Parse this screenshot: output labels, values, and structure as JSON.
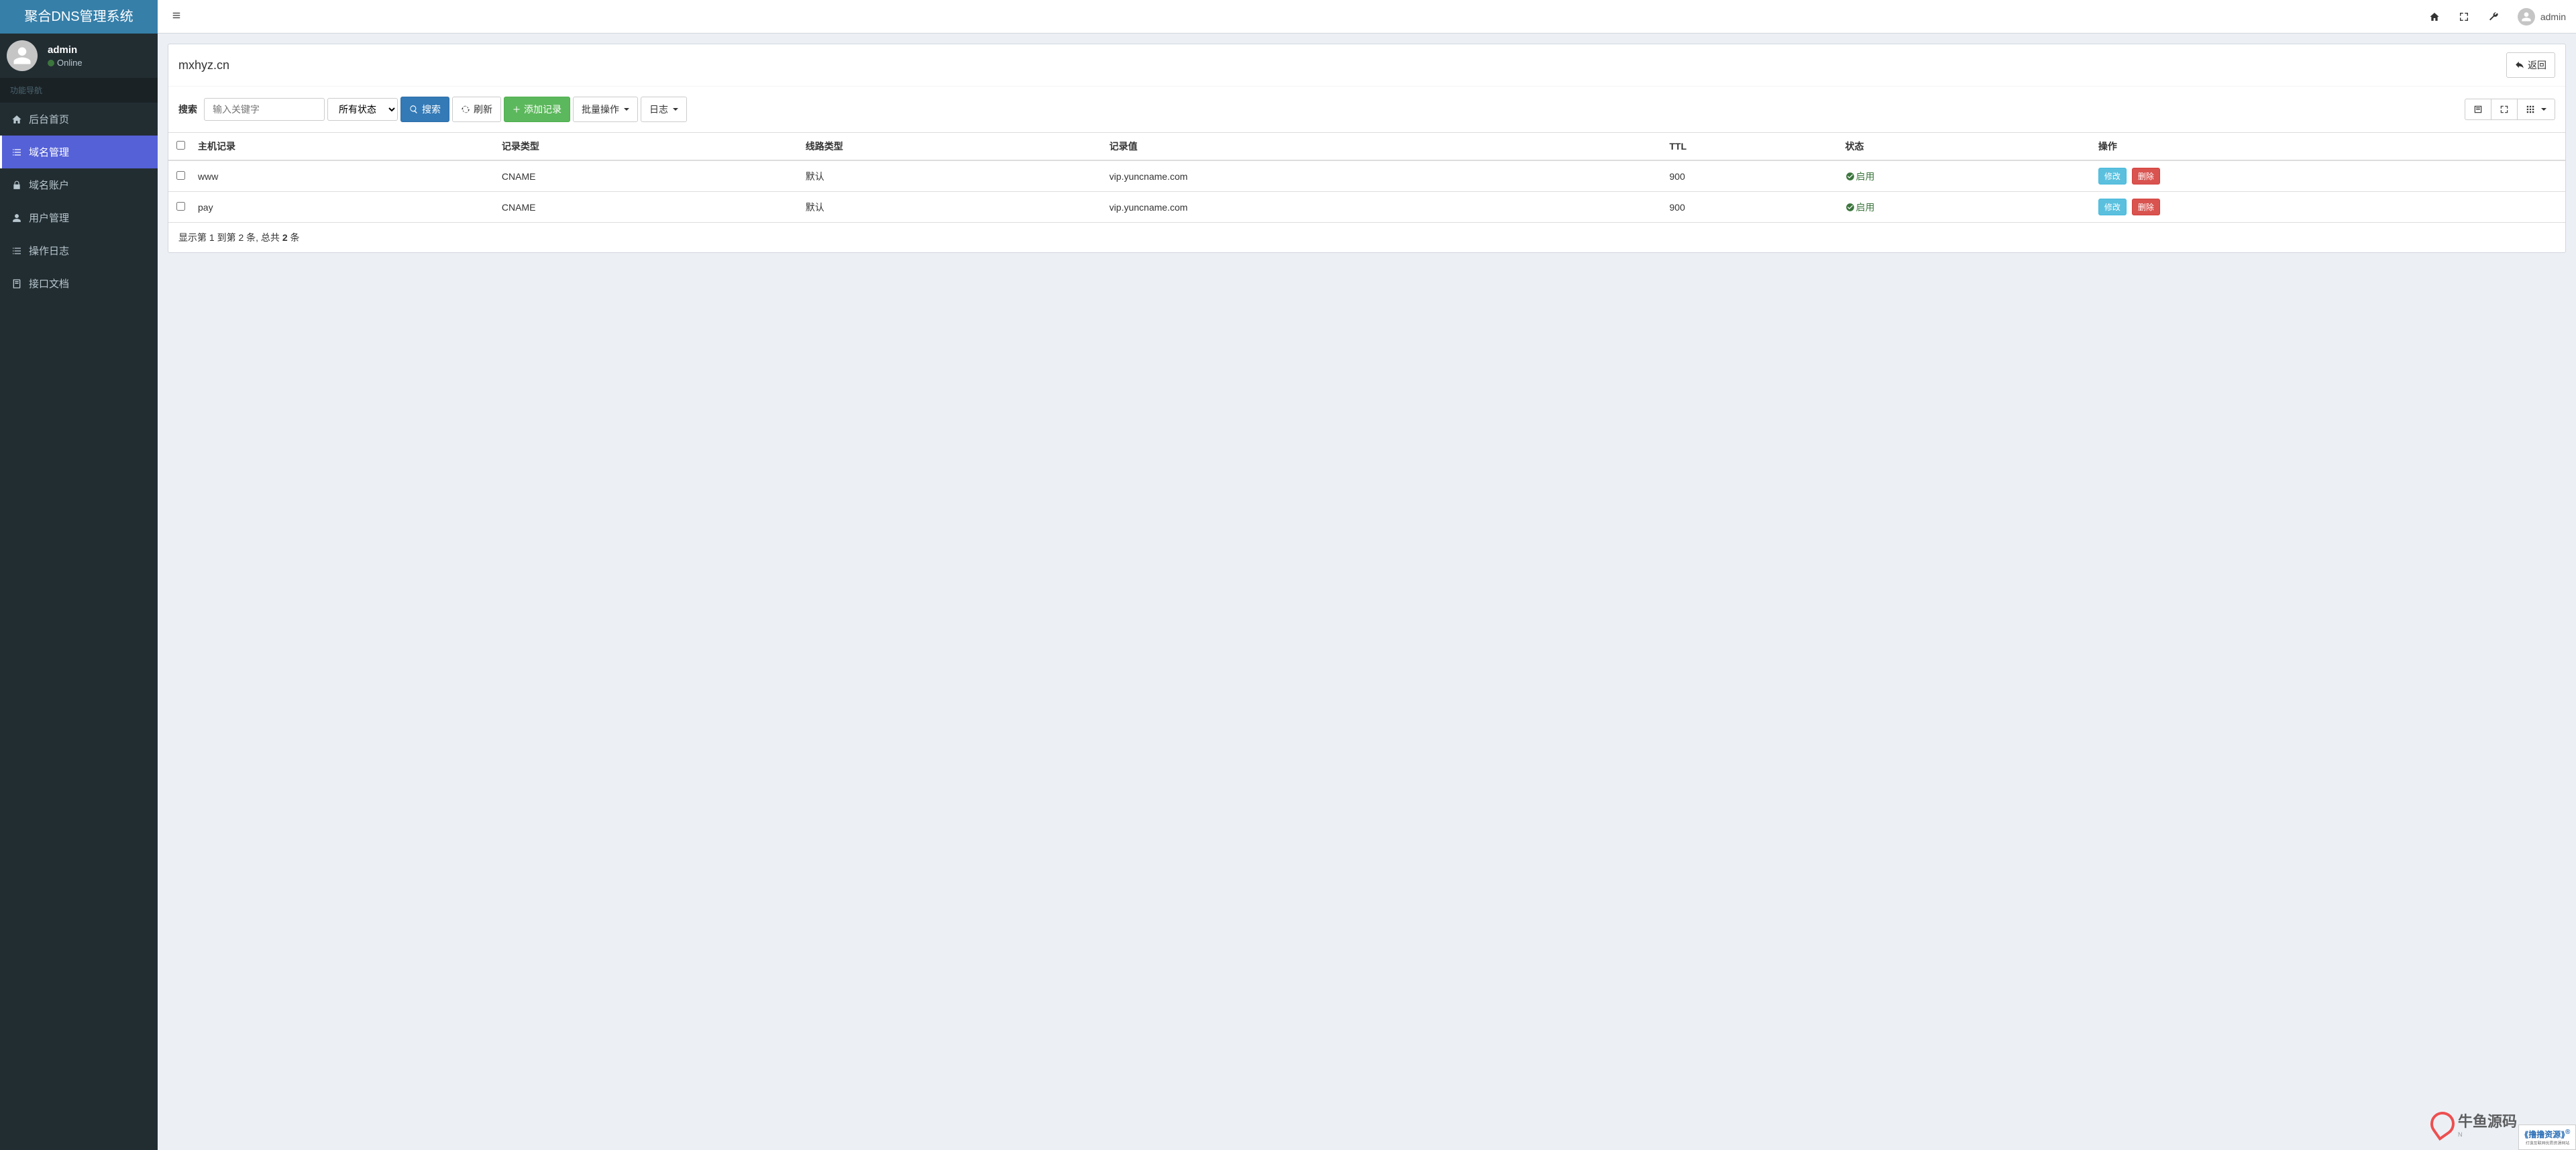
{
  "brand": "聚合DNS管理系统",
  "user": {
    "name": "admin",
    "status_label": "Online"
  },
  "nav": {
    "header": "功能导航",
    "items": [
      {
        "label": "后台首页"
      },
      {
        "label": "域名管理"
      },
      {
        "label": "域名账户"
      },
      {
        "label": "用户管理"
      },
      {
        "label": "操作日志"
      },
      {
        "label": "接口文档"
      }
    ]
  },
  "topbar": {
    "user_label": "admin"
  },
  "page": {
    "title": "mxhyz.cn",
    "back_label": "返回",
    "search_label": "搜索",
    "search_placeholder": "输入关键字",
    "status_filter": "所有状态",
    "search_button": "搜索",
    "refresh_label": "刷新",
    "add_label": "添加记录",
    "bulk_label": "批量操作",
    "log_label": "日志"
  },
  "table": {
    "headers": {
      "host": "主机记录",
      "type": "记录类型",
      "line": "线路类型",
      "value": "记录值",
      "ttl": "TTL",
      "status": "状态",
      "actions": "操作"
    },
    "status_enabled_label": "启用",
    "edit_label": "修改",
    "delete_label": "删除",
    "rows": [
      {
        "host": "www",
        "type": "CNAME",
        "line": "默认",
        "value": "vip.yuncname.com",
        "ttl": "900"
      },
      {
        "host": "pay",
        "type": "CNAME",
        "line": "默认",
        "value": "vip.yuncname.com",
        "ttl": "900"
      }
    ],
    "footer_prefix": "显示第 1 到第 2 条, 总共 ",
    "footer_total": "2",
    "footer_suffix": " 条"
  },
  "watermarks": {
    "w1_text": "牛鱼源码",
    "w1_sub": "N",
    "w2_top": "撸撸资源",
    "w2_sub": "打造互联网优质资源网站",
    "w2_reg": "®"
  }
}
